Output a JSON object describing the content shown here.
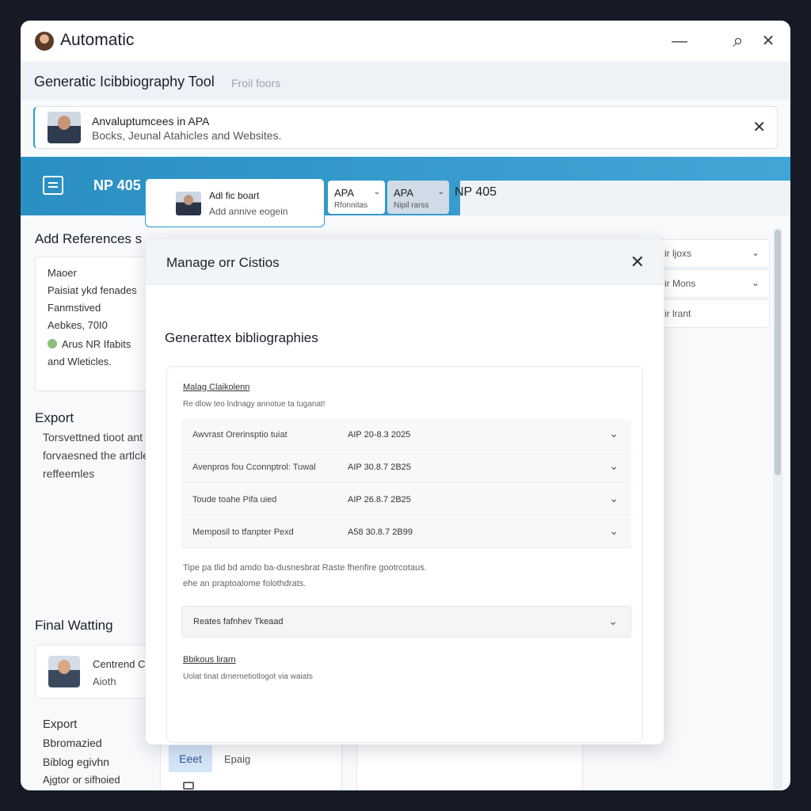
{
  "app": {
    "title": "Automatic",
    "controls": {
      "minimize": "—",
      "search": "⌕",
      "close": "✕"
    }
  },
  "subheader": {
    "title": "Generatic Icibbiography Tool",
    "hint": "Froil foors"
  },
  "notice": {
    "line1": "Anvaluptumcees in APA",
    "line2": "Bocks, Jeunal Atahicles and Websites.",
    "close": "✕"
  },
  "toolbar": {
    "title": "NP 405",
    "pill": {
      "line1": "Adl fic boart",
      "line2": "Add annive eogein"
    },
    "select1": {
      "value": "APA",
      "sub": "Rfonnitas"
    },
    "select2": {
      "value": "APA",
      "sub": "Nipil rarss"
    },
    "np_label": "NP 405",
    "chevron": "⌄"
  },
  "left": {
    "add_heading": "Add References s",
    "card_lines": [
      "Maoer",
      "Paisiat ykd fenades",
      "Fanmstived",
      "Aebkes, 70I0",
      "Arus NR Ifabits",
      "and Wleticles."
    ],
    "export_heading": "Export",
    "export_lines": [
      "Torsvettned tioot ant",
      "forvaesned the artlcle",
      "reffeemles"
    ],
    "final_heading": "Final Watting",
    "final_card": {
      "line1": "Centrend C",
      "line2": "Aioth"
    },
    "export2_heading": "Export",
    "export2_lines": [
      "Bbromazied",
      "Biblog egivhn",
      "Ajgtor or sifhoied"
    ]
  },
  "right": {
    "rows": [
      "ir ljoxs",
      "ir Mons",
      "ir lrant"
    ],
    "chevron": "⌄"
  },
  "bottom": {
    "edit_button": "Eeet",
    "edit_label": "Epaig"
  },
  "modal": {
    "title": "Manage orr Cistios",
    "close": "✕",
    "heading": "Generattex bibliographies",
    "link": "Malag Claikolenn",
    "desc": "Re dlow teo lndnagy annotue ta tuganat!",
    "rows": [
      {
        "name": "Awvrast Orerinsptio tuiat",
        "value": "AIP 20-8.3 2025"
      },
      {
        "name": "Avenpros fou Cconnptrol: Tuwal",
        "value": "AIP 30.8.7 2B25"
      },
      {
        "name": "Toude toahe Pifa uied",
        "value": "AIP 26.8.7 2B25"
      },
      {
        "name": "Memposil to tfanpter Pexd",
        "value": "A58 30.8.7 2B99"
      }
    ],
    "p1": "Tipe pa tlid bd amdo ba-dusnesbrat Raste fhenfire gootrcotaus.",
    "p2": "ehe an praptoalome folothdrats.",
    "expander": "Reates fafnhev Tkeaad",
    "link2": "Bbikous lirarn",
    "desc2": "Uolat tinat drnernetiotlogot via waiats",
    "chevron": "⌄"
  }
}
